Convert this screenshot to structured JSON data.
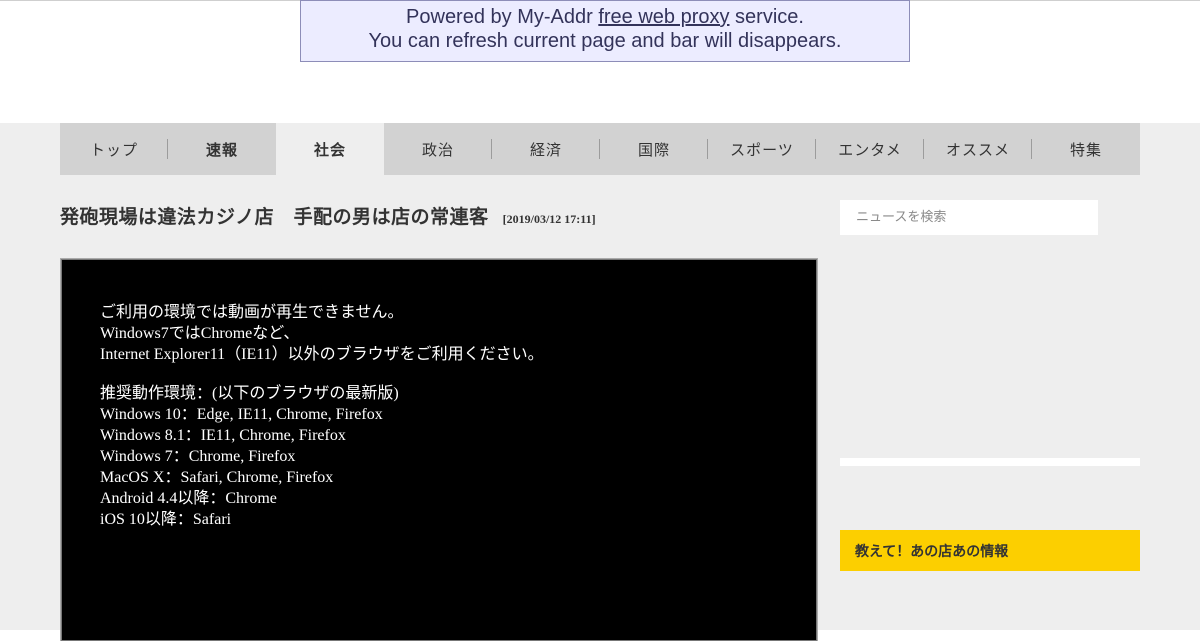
{
  "proxy_bar": {
    "line1_prefix": "Powered by My-Addr ",
    "line1_link": "free web proxy",
    "line1_suffix": " service.",
    "line2": "You can refresh current page and bar will disappears."
  },
  "nav": {
    "items": [
      {
        "label": "トップ"
      },
      {
        "label": "速報"
      },
      {
        "label": "社会"
      },
      {
        "label": "政治"
      },
      {
        "label": "経済"
      },
      {
        "label": "国際"
      },
      {
        "label": "スポーツ"
      },
      {
        "label": "エンタメ"
      },
      {
        "label": "オススメ"
      },
      {
        "label": "特集"
      }
    ],
    "active": "社会"
  },
  "article": {
    "headline": "発砲現場は違法カジノ店　手配の男は店の常連客",
    "timestamp": "[2019/03/12 17:11]"
  },
  "video": {
    "lines1": [
      "ご利用の環境では動画が再生できません。",
      "Windows7ではChromeなど、",
      "Internet Explorer11（IE11）以外のブラウザをご利用ください。"
    ],
    "lines2": [
      "推奨動作環境：(以下のブラウザの最新版)",
      "Windows 10：Edge, IE11, Chrome, Firefox",
      "Windows 8.1：IE11, Chrome, Firefox",
      "Windows 7：Chrome, Firefox",
      "MacOS X：Safari, Chrome, Firefox",
      "Android 4.4以降：Chrome",
      "iOS 10以降：Safari"
    ]
  },
  "sidebar": {
    "search_placeholder": "ニュースを検索",
    "promo_title": "教えて！あの店あの情報"
  },
  "colors": {
    "proxy_bg": "#ececff",
    "nav_bg": "#d2d2d2",
    "page_bg": "#eeeeee",
    "promo_bg": "#fccf00"
  }
}
